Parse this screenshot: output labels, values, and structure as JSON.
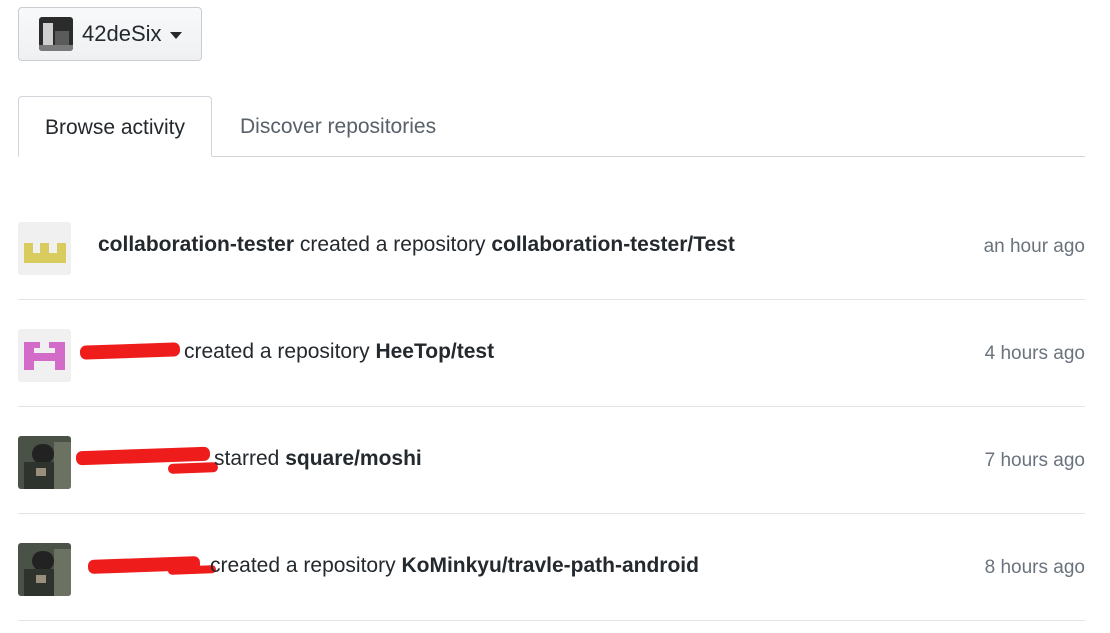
{
  "account": {
    "name": "42deSix"
  },
  "tabs": [
    {
      "label": "Browse activity",
      "selected": true
    },
    {
      "label": "Discover repositories",
      "selected": false
    }
  ],
  "feed": [
    {
      "actor": "collaboration-tester",
      "action": "created a repository",
      "target": "collaboration-tester/Test",
      "time": "an hour ago",
      "avatar": "yellow-identicon"
    },
    {
      "actor": "",
      "action": "created a repository",
      "target": "HeeTop/test",
      "time": "4 hours ago",
      "avatar": "pink-identicon"
    },
    {
      "actor": "",
      "action": "starred",
      "target": "square/moshi",
      "time": "7 hours ago",
      "avatar": "user-photo"
    },
    {
      "actor": "",
      "action": "created a repository",
      "target": "KoMinkyu/travle-path-android",
      "time": "8 hours ago",
      "avatar": "user-photo"
    }
  ],
  "colors": {
    "redaction": "#ef1c1c",
    "identicon_yellow": "#d9cc5f",
    "identicon_pink": "#d36bc8"
  }
}
